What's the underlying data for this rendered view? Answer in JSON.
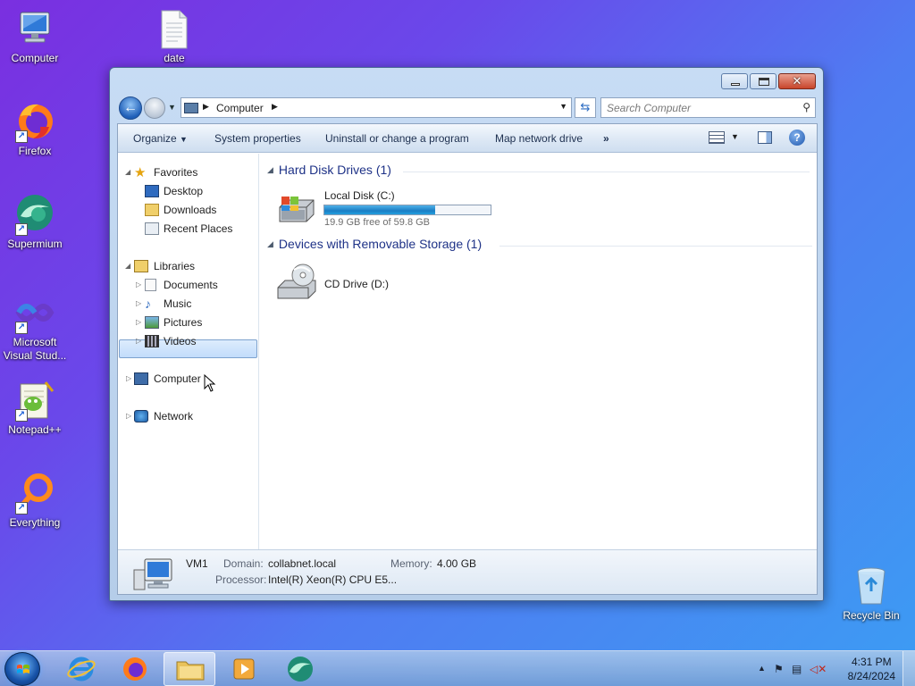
{
  "desktop": {
    "icons": [
      {
        "label": "Computer"
      },
      {
        "label": "date"
      },
      {
        "label": "Firefox"
      },
      {
        "label": "Supermium"
      },
      {
        "label": "Microsoft Visual Stud..."
      },
      {
        "label": "Notepad++"
      },
      {
        "label": "Everything"
      },
      {
        "label": "Recycle Bin"
      }
    ]
  },
  "window": {
    "address": {
      "location": "Computer"
    },
    "search": {
      "placeholder": "Search Computer"
    },
    "command_bar": {
      "organize": "Organize",
      "system_properties": "System properties",
      "uninstall": "Uninstall or change a program",
      "map_drive": "Map network drive",
      "more": "»"
    },
    "nav": {
      "favorites": "Favorites",
      "desktop": "Desktop",
      "downloads": "Downloads",
      "recent": "Recent Places",
      "libraries": "Libraries",
      "documents": "Documents",
      "music": "Music",
      "pictures": "Pictures",
      "videos": "Videos",
      "computer": "Computer",
      "network": "Network"
    },
    "content": {
      "group_hdd": "Hard Disk Drives (1)",
      "group_removable": "Devices with Removable Storage (1)",
      "drive_c": {
        "name": "Local Disk (C:)",
        "free_text": "19.9 GB free of 59.8 GB",
        "used_fraction": 0.667
      },
      "drive_d": {
        "name": "CD Drive (D:)"
      }
    },
    "details": {
      "computer_name": "VM1",
      "domain_label": "Domain:",
      "domain_value": "collabnet.local",
      "memory_label": "Memory:",
      "memory_value": "4.00 GB",
      "processor_label": "Processor:",
      "processor_value": "Intel(R) Xeon(R) CPU E5..."
    }
  },
  "taskbar": {
    "time": "4:31 PM",
    "date": "8/24/2024"
  },
  "colors": {
    "group_header": "#1e3287",
    "capacity_fill": "#1a7dc4",
    "selection": "#c2dcfb"
  }
}
